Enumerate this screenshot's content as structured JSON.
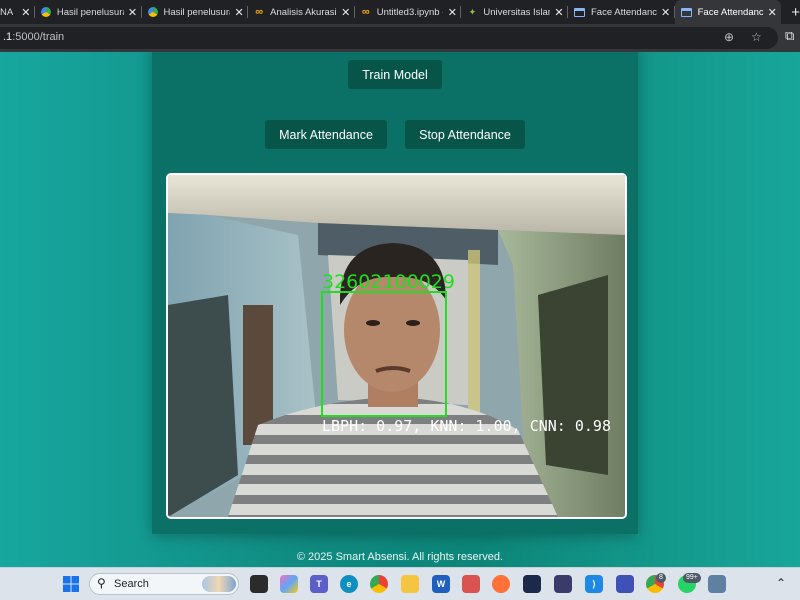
{
  "browser": {
    "tabs": [
      {
        "title": "NA",
        "favicon": "window-icon"
      },
      {
        "title": "Hasil penelusuran",
        "favicon": "drive-icon"
      },
      {
        "title": "Hasil penelusuran",
        "favicon": "drive-icon"
      },
      {
        "title": "Analisis Akurasi -",
        "favicon": "colab-icon"
      },
      {
        "title": "Untitled3.ipynb -",
        "favicon": "colab-icon"
      },
      {
        "title": "Universitas Islam",
        "favicon": "leaf-icon"
      },
      {
        "title": "Face Attendance",
        "favicon": "window-icon"
      },
      {
        "title": "Face Attendance",
        "favicon": "window-icon"
      }
    ],
    "address_host": ".1",
    "address_rest": ":5000/train"
  },
  "page": {
    "train_button": "Train Model",
    "mark_button": "Mark Attendance",
    "stop_button": "Stop Attendance",
    "detection_id": "32602100029",
    "detection_scores": "LBPH: 0.97, KNN: 1.00, CNN: 0.98",
    "footer": "© 2025 Smart Absensi. All rights reserved."
  },
  "taskbar": {
    "search_label": "Search",
    "badges": {
      "chrome": "8",
      "whatsapp": "99+"
    }
  }
}
